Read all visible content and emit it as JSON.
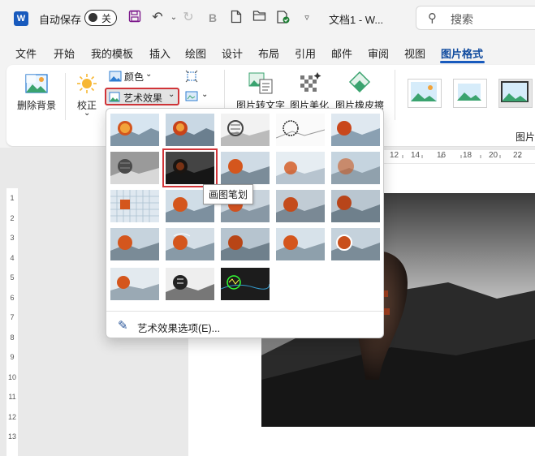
{
  "titlebar": {
    "autosave_label": "自动保存",
    "autosave_state": "关",
    "document_title": "文档1 - W...",
    "search_placeholder": "搜索"
  },
  "tabs": [
    "文件",
    "开始",
    "我的模板",
    "插入",
    "绘图",
    "设计",
    "布局",
    "引用",
    "邮件",
    "审阅",
    "视图",
    "图片格式"
  ],
  "active_tab": "图片格式",
  "ribbon": {
    "remove_background": "删除背景",
    "corrections": "校正",
    "color": "颜色",
    "artistic_effects": "艺术效果",
    "picture_to_text": "图片转文字",
    "picture_beautify": "图片美化",
    "picture_eraser": "图片橡皮擦",
    "group_label": "图片"
  },
  "gallery": {
    "options_label": "艺术效果选项(E)...",
    "selected_index": 6,
    "tooltip": "画图笔划"
  },
  "ruler": {
    "top_ticks": [
      "12",
      "14",
      "16",
      "18",
      "20",
      "22"
    ],
    "left_ticks": [
      "1",
      "2",
      "3",
      "4",
      "5",
      "6",
      "7",
      "8",
      "9",
      "10",
      "11",
      "12",
      "13"
    ]
  },
  "colors": {
    "accent": "#185abd",
    "selection_red": "#d13438",
    "background": "#f3f3f3"
  }
}
